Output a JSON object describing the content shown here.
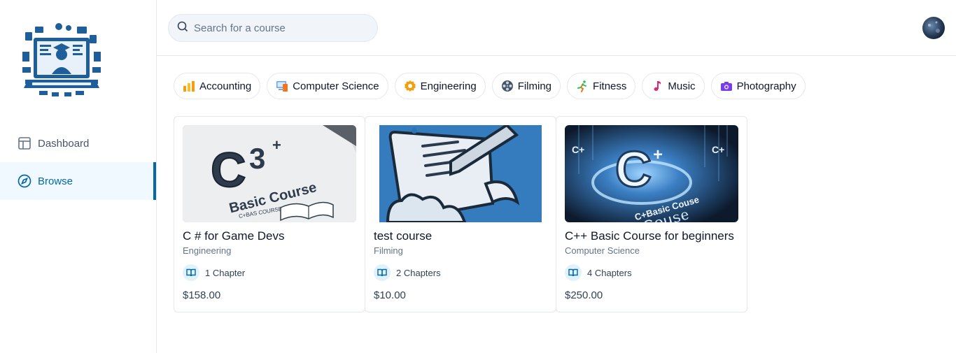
{
  "sidebar": {
    "items": [
      {
        "label": "Dashboard",
        "icon": "layout-icon"
      },
      {
        "label": "Browse",
        "icon": "compass-icon",
        "active": true
      }
    ]
  },
  "search": {
    "placeholder": "Search for a course",
    "value": ""
  },
  "categories": [
    {
      "label": "Accounting",
      "icon": "chart-bars-icon"
    },
    {
      "label": "Computer Science",
      "icon": "computer-icon"
    },
    {
      "label": "Engineering",
      "icon": "gear-icon"
    },
    {
      "label": "Filming",
      "icon": "film-reel-icon"
    },
    {
      "label": "Fitness",
      "icon": "runner-icon"
    },
    {
      "label": "Music",
      "icon": "music-note-icon"
    },
    {
      "label": "Photography",
      "icon": "camera-icon"
    }
  ],
  "courses": [
    {
      "title": "C # for Game Devs",
      "category": "Engineering",
      "chapters": "1 Chapter",
      "price": "$158.00"
    },
    {
      "title": "test course",
      "category": "Filming",
      "chapters": "2 Chapters",
      "price": "$10.00"
    },
    {
      "title": "C++ Basic Course for beginners",
      "category": "Computer Science",
      "chapters": "4 Chapters",
      "price": "$250.00"
    }
  ],
  "colors": {
    "accent": "#0369a1",
    "accent_bg": "#f0f9ff",
    "chip_border": "#e2e8f0"
  }
}
